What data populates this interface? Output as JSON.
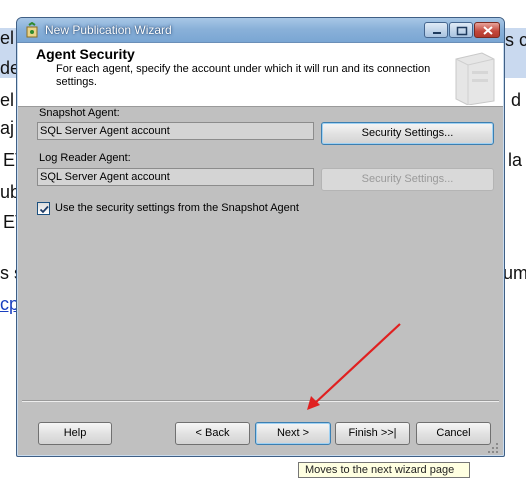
{
  "background": {
    "fragments": [
      "el",
      "s c",
      "de",
      "el",
      "d",
      "aj",
      "ET",
      "la",
      "ub",
      "ET",
      "s s",
      "um",
      "cp"
    ]
  },
  "window": {
    "title": "New Publication Wizard"
  },
  "header": {
    "title": "Agent Security",
    "subtitle": "For each agent, specify the account under which it will run and its connection settings."
  },
  "snapshot_agent": {
    "label": "Snapshot Agent:",
    "value": "SQL Server Agent account",
    "button": "Security Settings..."
  },
  "log_reader_agent": {
    "label": "Log Reader Agent:",
    "value": "SQL Server Agent account",
    "button": "Security Settings..."
  },
  "use_snapshot_settings": {
    "label": "Use the security settings from the Snapshot Agent",
    "checked": true
  },
  "footer": {
    "help": "Help",
    "back": "< Back",
    "next": "Next >",
    "finish": "Finish >>|",
    "cancel": "Cancel"
  },
  "tooltip": "Moves to the next wizard page",
  "colors": {
    "annotation_arrow": "#e02020",
    "dialog_body": "#c0c0c0",
    "titlebar": "#8ab1d9"
  }
}
